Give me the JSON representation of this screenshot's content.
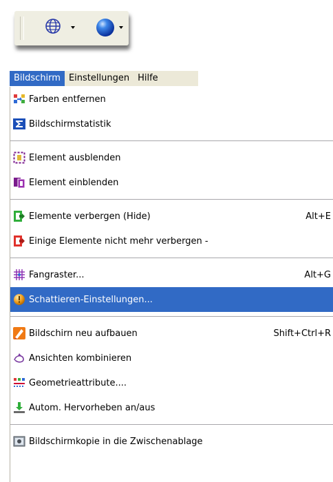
{
  "toolbar": {
    "buttons": [
      {
        "icon": "globe-wireframe-icon",
        "has_dropdown": true
      },
      {
        "icon": "blue-sphere-icon",
        "has_dropdown": true
      }
    ]
  },
  "menubar": {
    "items": [
      {
        "label": "Bildschirm",
        "active": true
      },
      {
        "label": "Einstellungen"
      },
      {
        "label": "Hilfe"
      }
    ]
  },
  "menu": {
    "groups": [
      [
        {
          "icon": "remove-colors-icon",
          "label": "Farben entfernen",
          "shortcut": ""
        },
        {
          "icon": "sigma-icon",
          "label": "Bildschirmstatistik",
          "shortcut": ""
        }
      ],
      [
        {
          "icon": "hide-element-icon",
          "label": "Element ausblenden",
          "shortcut": ""
        },
        {
          "icon": "show-element-icon",
          "label": "Element einblenden",
          "shortcut": ""
        }
      ],
      [
        {
          "icon": "hide-elements-icon",
          "label": "Elemente verbergen (Hide)",
          "shortcut": "Alt+E"
        },
        {
          "icon": "unhide-elements-icon",
          "label": "Einige Elemente nicht mehr verbergen -",
          "shortcut": ""
        }
      ],
      [
        {
          "icon": "snap-grid-icon",
          "label": "Fangraster...",
          "shortcut": "Alt+G"
        },
        {
          "icon": "shading-settings-icon",
          "label": "Schattieren-Einstellungen...",
          "shortcut": "",
          "highlighted": true
        }
      ],
      [
        {
          "icon": "rebuild-screen-icon",
          "label": "Bildschirn neu aufbauen",
          "shortcut": "Shift+Ctrl+R"
        },
        {
          "icon": "combine-views-icon",
          "label": "Ansichten kombinieren",
          "shortcut": ""
        },
        {
          "icon": "geometry-attributes-icon",
          "label": "Geometrieattribute....",
          "shortcut": ""
        },
        {
          "icon": "auto-highlight-icon",
          "label": "Autom. Hervorheben an/aus",
          "shortcut": ""
        }
      ],
      [
        {
          "icon": "clipboard-screenshot-icon",
          "label": "Bildschirmkopie in die Zwischenablage",
          "shortcut": ""
        }
      ]
    ]
  },
  "colors": {
    "highlight": "#316ac5",
    "menubar_bg": "#ece9d8",
    "toolbar_bg": "#efeee2"
  }
}
